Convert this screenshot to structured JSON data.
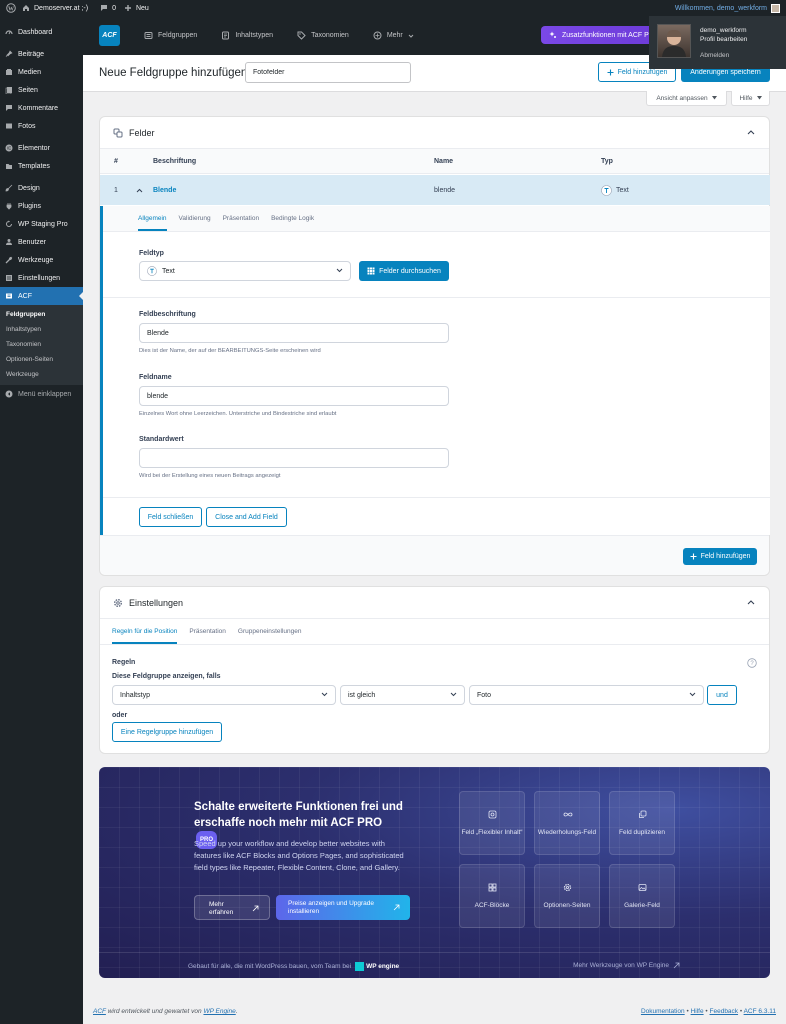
{
  "adminbar": {
    "site_name": "Demoserver.at ;-)",
    "comments_count": "0",
    "new_label": "Neu",
    "greeting": "Willkommen, demo_werkform"
  },
  "user_popup": {
    "username": "demo_werkform",
    "edit_profile": "Profil bearbeiten",
    "logout": "Abmelden"
  },
  "sidebar": {
    "items": [
      {
        "label": "Dashboard",
        "icon": "dashboard-icon"
      },
      {
        "label": "Beiträge",
        "icon": "pin-icon"
      },
      {
        "label": "Medien",
        "icon": "media-icon"
      },
      {
        "label": "Seiten",
        "icon": "pages-icon"
      },
      {
        "label": "Kommentare",
        "icon": "comment-icon"
      },
      {
        "label": "Fotos",
        "icon": "photo-icon"
      },
      {
        "label": "Elementor",
        "icon": "elementor-icon"
      },
      {
        "label": "Templates",
        "icon": "folder-icon"
      },
      {
        "label": "Design",
        "icon": "brush-icon"
      },
      {
        "label": "Plugins",
        "icon": "plugin-icon"
      },
      {
        "label": "WP Staging Pro",
        "icon": "sync-icon"
      },
      {
        "label": "Benutzer",
        "icon": "user-icon"
      },
      {
        "label": "Werkzeuge",
        "icon": "wrench-icon"
      },
      {
        "label": "Einstellungen",
        "icon": "settings-icon"
      },
      {
        "label": "ACF",
        "icon": "acf-icon"
      }
    ],
    "submenu": [
      "Feldgruppen",
      "Inhaltstypen",
      "Taxonomien",
      "Optionen-Seiten",
      "Werkzeuge"
    ],
    "collapse": "Menü einklappen"
  },
  "acf_header": {
    "logo": "ACF",
    "tabs": [
      "Feldgruppen",
      "Inhaltstypen",
      "Taxonomien",
      "Mehr"
    ],
    "pro_button": "Zusatzfunktionen mit ACF PRO"
  },
  "titlebar": {
    "title": "Neue Feldgruppe hinzufügen",
    "group_name": "Fotofelder",
    "add_field": "Feld hinzufügen",
    "save": "Änderungen speichern"
  },
  "screen_meta": {
    "options": "Ansicht anpassen",
    "help": "Hilfe"
  },
  "fields_panel": {
    "title": "Felder",
    "columns": [
      "#",
      "Beschriftung",
      "Name",
      "Typ"
    ],
    "row": {
      "order": "1",
      "label": "Blende",
      "name": "blende",
      "type": "Text"
    },
    "tabs": [
      "Allgemein",
      "Validierung",
      "Präsentation",
      "Bedingte Logik"
    ],
    "field_type_label": "Feldtyp",
    "field_type_value": "Text",
    "browse_fields": "Felder durchsuchen",
    "label_label": "Feldbeschriftung",
    "label_value": "Blende",
    "label_desc": "Dies ist der Name, der auf der BEARBEITUNGS-Seite erscheinen wird",
    "name_label": "Feldname",
    "name_value": "blende",
    "name_desc": "Einzelnes Wort ohne Leerzeichen. Unterstriche und Bindestriche sind erlaubt",
    "default_label": "Standardwert",
    "default_value": "",
    "default_desc": "Wird bei der Erstellung eines neuen Beitrags angezeigt",
    "close_field": "Feld schließen",
    "close_add": "Close and Add Field",
    "add_field": "Feld hinzufügen"
  },
  "settings_panel": {
    "title": "Einstellungen",
    "tabs": [
      "Regeln für die Position",
      "Präsentation",
      "Gruppeneinstellungen"
    ],
    "rules_label": "Regeln",
    "show_if": "Diese Feldgruppe anzeigen, falls",
    "param": "Inhaltstyp",
    "operator": "ist gleich",
    "value": "Foto",
    "and": "und",
    "or": "oder",
    "add_rule_group": "Eine Regelgruppe hinzufügen"
  },
  "promo": {
    "title": "Schalte erweiterte Funktionen frei und erschaffe noch mehr mit ACF PRO",
    "badge": "PRO",
    "text": "Speed up your workflow and develop better websites with features like ACF Blocks and Options Pages, and sophisticated field types like Repeater, Flexible Content, Clone, and Gallery.",
    "btn_more": "Mehr erfahren",
    "btn_pricing": "Preise anzeigen und Upgrade installieren",
    "features": [
      {
        "label": "Feld „Flexibler Inhalt“",
        "icon": "flexible-content-icon"
      },
      {
        "label": "Wiederholungs-Feld",
        "icon": "infinity-icon"
      },
      {
        "label": "Feld duplizieren",
        "icon": "duplicate-icon"
      },
      {
        "label": "ACF-Blöcke",
        "icon": "blocks-icon"
      },
      {
        "label": "Optionen-Seiten",
        "icon": "gear-icon"
      },
      {
        "label": "Galerie-Feld",
        "icon": "gallery-icon"
      }
    ],
    "footer_left": "Gebaut für alle, die mit WordPress bauen, vom Team bei",
    "footer_brand": "WP engine",
    "footer_right": "Mehr Werkzeuge von WP Engine"
  },
  "footer": {
    "acf": "ACF",
    "text": " wird entwickelt und gewartet von ",
    "wpengine": "WP Engine",
    "links": [
      "Dokumentation",
      "Hilfe",
      "Feedback",
      "ACF 6.3.11"
    ]
  },
  "colors": {
    "accent": "#0783be",
    "admin_dark": "#1d2327",
    "wp_blue": "#2271b1",
    "pro_purple": "#7a48e6"
  }
}
